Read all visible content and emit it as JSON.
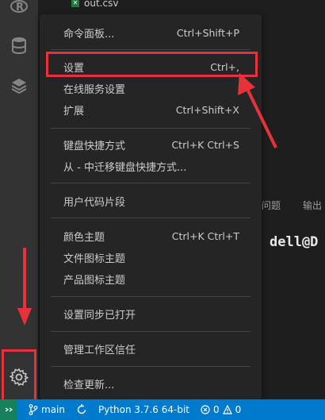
{
  "explorer": {
    "file_name": "out.csv"
  },
  "panel": {
    "tabs": [
      "问题",
      "输出"
    ]
  },
  "terminal": {
    "prompt": "dell@D"
  },
  "menu": {
    "items": [
      {
        "label": "命令面板...",
        "shortcut": "Ctrl+Shift+P"
      },
      {
        "label": "设置",
        "shortcut": "Ctrl+,"
      },
      {
        "label": "在线服务设置",
        "shortcut": ""
      },
      {
        "label": "扩展",
        "shortcut": "Ctrl+Shift+X"
      },
      {
        "label": "键盘快捷方式",
        "shortcut": "Ctrl+K Ctrl+S"
      },
      {
        "label": "从 - 中迁移键盘快捷方式...",
        "shortcut": ""
      },
      {
        "label": "用户代码片段",
        "shortcut": ""
      },
      {
        "label": "颜色主题",
        "shortcut": "Ctrl+K Ctrl+T"
      },
      {
        "label": "文件图标主题",
        "shortcut": ""
      },
      {
        "label": "产品图标主题",
        "shortcut": ""
      },
      {
        "label": "设置同步已打开",
        "shortcut": ""
      },
      {
        "label": "管理工作区信任",
        "shortcut": ""
      },
      {
        "label": "检查更新...",
        "shortcut": ""
      }
    ]
  },
  "status_bar": {
    "branch": "main",
    "interpreter": "Python 3.7.6 64-bit",
    "errors": "0",
    "warnings": "0"
  },
  "colors": {
    "annotation": "#e8323a",
    "status_bar": "#007acc",
    "remote_button": "#16825d"
  },
  "icons": [
    "r-language-icon",
    "database-icon",
    "layers-icon",
    "gear-icon",
    "git-branch-icon",
    "sync-icon",
    "error-icon",
    "warning-icon"
  ]
}
